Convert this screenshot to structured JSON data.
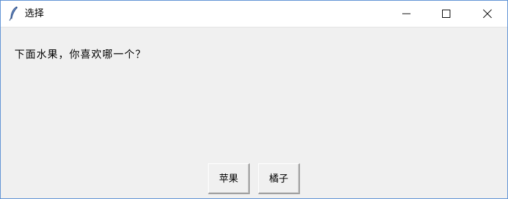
{
  "window": {
    "title": "选择",
    "controls": {
      "minimize_icon": "minimize-icon",
      "maximize_icon": "maximize-icon",
      "close_icon": "close-icon"
    }
  },
  "dialog": {
    "prompt": "下面水果，你喜欢哪一个？",
    "buttons": [
      {
        "label": "苹果"
      },
      {
        "label": "橘子"
      }
    ]
  },
  "colors": {
    "background": "#f0f0f0",
    "titlebar": "#ffffff",
    "window_border": "#5a8fd4"
  }
}
